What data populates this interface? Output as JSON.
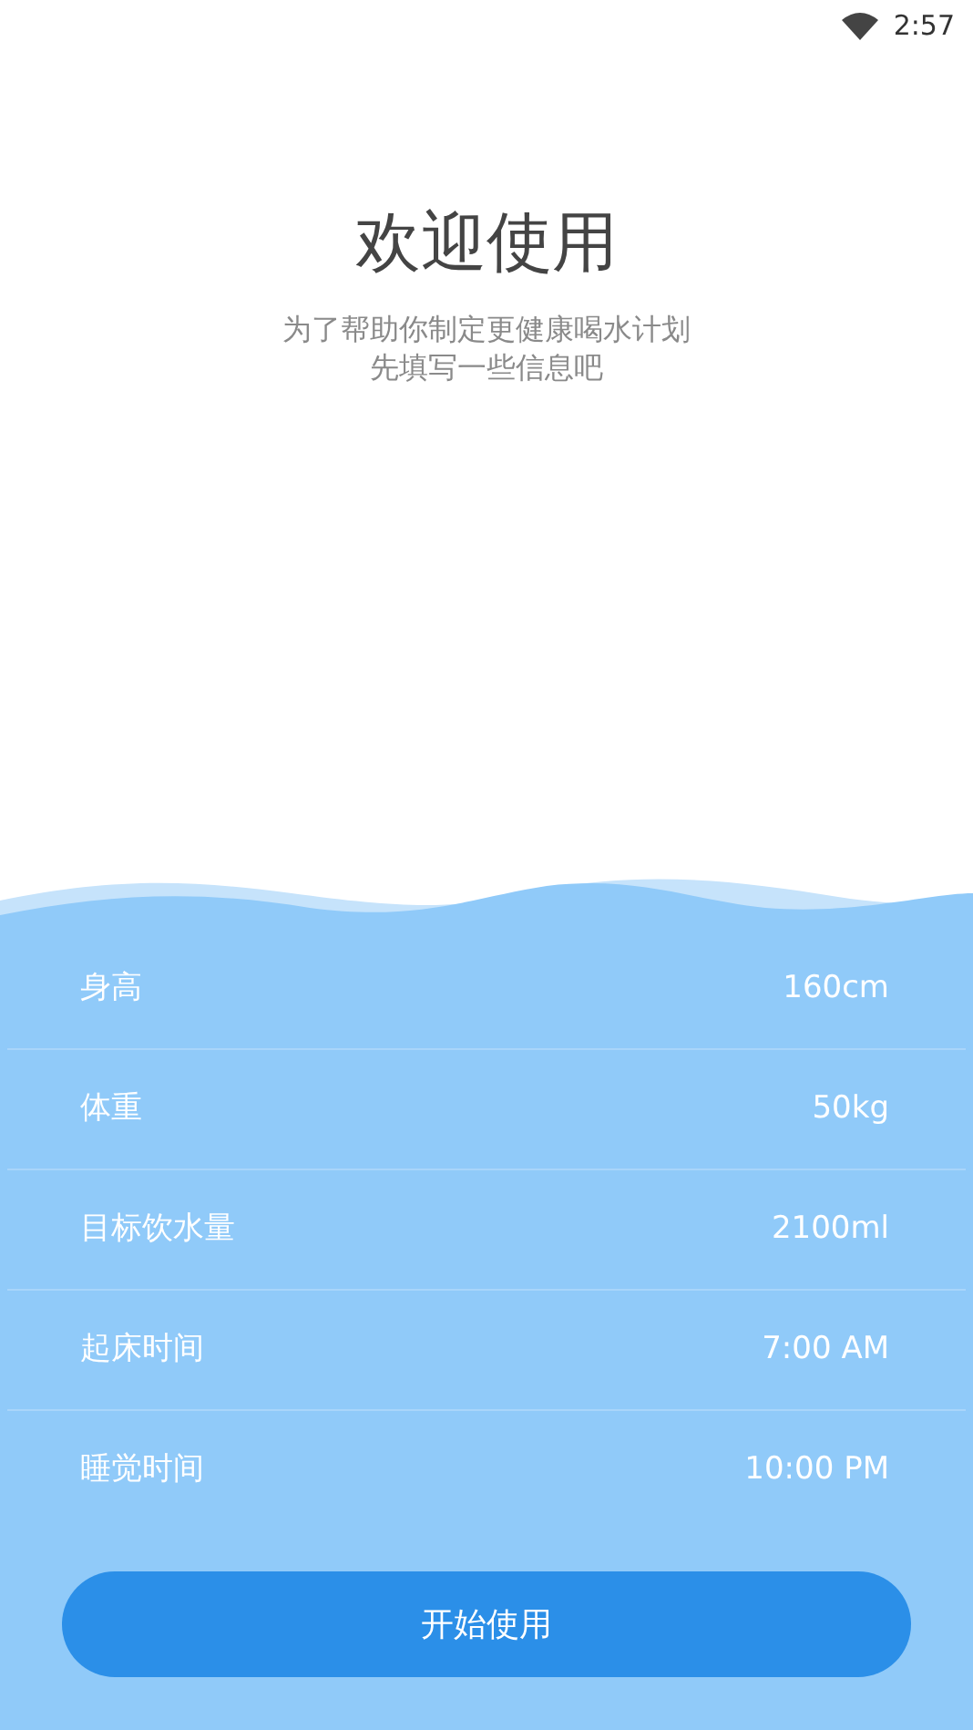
{
  "status_bar": {
    "time": "2:57"
  },
  "title": "欢迎使用",
  "subtitle": [
    "为了帮助你制定更健康喝水计划",
    "先填写一些信息吧"
  ],
  "fields": [
    {
      "label": "身高",
      "value": "160cm"
    },
    {
      "label": "体重",
      "value": "50kg"
    },
    {
      "label": "目标饮水量",
      "value": "2100ml"
    },
    {
      "label": "起床时间",
      "value": "7:00 AM"
    },
    {
      "label": "睡觉时间",
      "value": "10:00 PM"
    }
  ],
  "start_button": "开始使用"
}
